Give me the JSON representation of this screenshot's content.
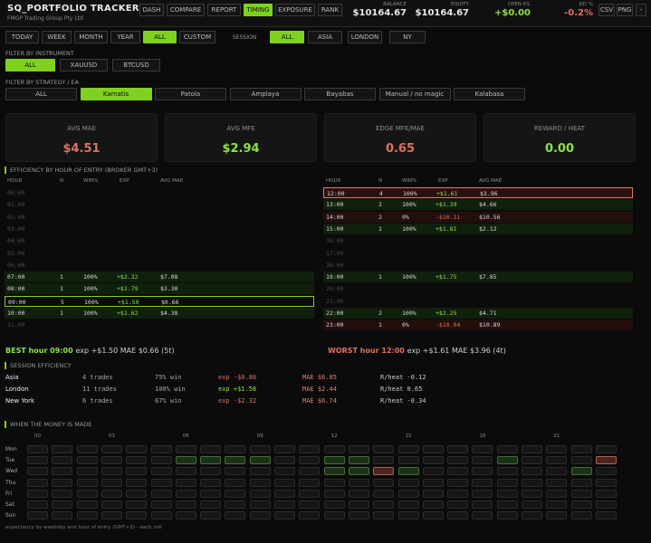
{
  "header": {
    "brand": "SQ_PORTFOLIO TRACKER",
    "company": "FMGP Trading Group Pty Ltd",
    "nav": [
      "DASH",
      "COMPARE",
      "REPORT",
      "TIMING",
      "EXPOSURE",
      "RANK"
    ],
    "nav_active": "TIMING",
    "stats": [
      {
        "label": "BALANCE",
        "value": "$10164.67",
        "color": "#e8e8e8"
      },
      {
        "label": "EQUITY",
        "value": "$10164.67",
        "color": "#e8e8e8"
      },
      {
        "label": "OPEN P/L",
        "value": "+$0.00",
        "color": "#8de04a"
      },
      {
        "label": "DD %",
        "value": "-0.2%",
        "color": "#e0705e"
      }
    ],
    "exports": [
      "CSV",
      "PNG",
      "-"
    ]
  },
  "periods": [
    "TODAY",
    "WEEK",
    "MONTH",
    "YEAR",
    "ALL",
    "CUSTOM"
  ],
  "period_active": "ALL",
  "session_label": "SESSION",
  "sessions": [
    "ALL",
    "ASIA",
    "LONDON",
    "NY"
  ],
  "session_active": "ALL",
  "instrument_label": "FILTER BY INSTRUMENT",
  "instruments": [
    "ALL",
    "XAUUSD",
    "BTCUSD"
  ],
  "instrument_active": "ALL",
  "strategy_label": "FILTER BY STRATEGY / EA",
  "strategies": [
    "ALL",
    "Kamatis",
    "Patola",
    "Amplaya",
    "Bayabas",
    "Manual / no magic",
    "Kalabasa"
  ],
  "strategy_active": "Kamatis",
  "cards": [
    {
      "title": "AVG MAE",
      "value": "$4.51",
      "color": "#e0705e"
    },
    {
      "title": "AVG MFE",
      "value": "$2.94",
      "color": "#8de04a"
    },
    {
      "title": "EDGE  MFE/MAE",
      "value": "0.65",
      "color": "#e0705e"
    },
    {
      "title": "REWARD / HEAT",
      "value": "0.00",
      "color": "#8de04a"
    }
  ],
  "efficiency_title": "EFFICIENCY BY HOUR OF ENTRY (broker GMT+3)",
  "table_headers": [
    "HOUR",
    "N",
    "WIN%",
    "EXP",
    "AVG MAE"
  ],
  "hours_left": [
    {
      "h": "00:00",
      "n": "",
      "w": "",
      "e": "",
      "m": "",
      "s": ""
    },
    {
      "h": "01:00",
      "n": "",
      "w": "",
      "e": "",
      "m": "",
      "s": ""
    },
    {
      "h": "02:00",
      "n": "",
      "w": "",
      "e": "",
      "m": "",
      "s": ""
    },
    {
      "h": "03:00",
      "n": "",
      "w": "",
      "e": "",
      "m": "",
      "s": ""
    },
    {
      "h": "04:00",
      "n": "",
      "w": "",
      "e": "",
      "m": "",
      "s": ""
    },
    {
      "h": "05:00",
      "n": "",
      "w": "",
      "e": "",
      "m": "",
      "s": ""
    },
    {
      "h": "06:00",
      "n": "",
      "w": "",
      "e": "",
      "m": "",
      "s": ""
    },
    {
      "h": "07:00",
      "n": "1",
      "w": "100%",
      "e": "+$2.32",
      "m": "$7.08",
      "s": "pos"
    },
    {
      "h": "08:00",
      "n": "1",
      "w": "100%",
      "e": "+$1.79",
      "m": "$3.30",
      "s": "pos"
    },
    {
      "h": "09:00",
      "n": "5",
      "w": "100%",
      "e": "+$1.50",
      "m": "$0.66",
      "s": "best"
    },
    {
      "h": "10:00",
      "n": "1",
      "w": "100%",
      "e": "+$1.62",
      "m": "$4.38",
      "s": "pos"
    },
    {
      "h": "11:00",
      "n": "",
      "w": "",
      "e": "",
      "m": "",
      "s": ""
    }
  ],
  "hours_right": [
    {
      "h": "12:00",
      "n": "4",
      "w": "100%",
      "e": "+$1.61",
      "m": "$3.96",
      "s": "worst"
    },
    {
      "h": "13:00",
      "n": "2",
      "w": "100%",
      "e": "+$1.39",
      "m": "$4.66",
      "s": "pos"
    },
    {
      "h": "14:00",
      "n": "2",
      "w": "0%",
      "e": "-$10.11",
      "m": "$10.56",
      "s": "neg"
    },
    {
      "h": "15:00",
      "n": "1",
      "w": "100%",
      "e": "+$1.81",
      "m": "$2.12",
      "s": "pos"
    },
    {
      "h": "16:00",
      "n": "",
      "w": "",
      "e": "",
      "m": "",
      "s": ""
    },
    {
      "h": "17:00",
      "n": "",
      "w": "",
      "e": "",
      "m": "",
      "s": ""
    },
    {
      "h": "18:00",
      "n": "",
      "w": "",
      "e": "",
      "m": "",
      "s": ""
    },
    {
      "h": "19:00",
      "n": "1",
      "w": "100%",
      "e": "+$1.75",
      "m": "$7.85",
      "s": "pos"
    },
    {
      "h": "20:00",
      "n": "",
      "w": "",
      "e": "",
      "m": "",
      "s": ""
    },
    {
      "h": "21:00",
      "n": "",
      "w": "",
      "e": "",
      "m": "",
      "s": ""
    },
    {
      "h": "22:00",
      "n": "2",
      "w": "100%",
      "e": "+$2.25",
      "m": "$4.71",
      "s": "pos"
    },
    {
      "h": "23:00",
      "n": "1",
      "w": "0%",
      "e": "-$10.04",
      "m": "$10.89",
      "s": "neg"
    }
  ],
  "best": {
    "label": "BEST hour 09:00",
    "exp": "exp +$1.50",
    "mae": "MAE $0.66",
    "count": "(5t)"
  },
  "worst": {
    "label": "WORST hour 12:00",
    "exp": "exp +$1.61",
    "mae": "MAE $3.96",
    "count": "(4t)"
  },
  "session_title": "SESSION EFFICIENCY",
  "session_rows": [
    {
      "name": "Asia",
      "trades": "4 trades",
      "win": "75% win",
      "exp": "exp -$0.80",
      "mae": "MAE $6.85",
      "heat": "R/heat -0.12"
    },
    {
      "name": "London",
      "trades": "11 trades",
      "win": "100% win",
      "exp": "exp +$1.58",
      "mae": "MAE $2.44",
      "heat": "R/heat 0.65"
    },
    {
      "name": "New York",
      "trades": "6 trades",
      "win": "67% win",
      "exp": "exp -$2.32",
      "mae": "MAE $6.74",
      "heat": "R/heat -0.34"
    }
  ],
  "heatmap_title": "WHEN THE MONEY IS MADE",
  "heatmap_hour_labels": [
    "00",
    "03",
    "06",
    "09",
    "12",
    "15",
    "18",
    "21"
  ],
  "heatmap_days": [
    "Mon",
    "Tue",
    "Wed",
    "Thu",
    "Fri",
    "Sat",
    "Sun"
  ],
  "heatmap_cells": {
    "Tue": {
      "7": "pos",
      "8": "pos",
      "9": "pos",
      "10": "pos",
      "13": "pos",
      "14": "pos",
      "20": "pos",
      "24": "neg"
    },
    "Wed": {
      "13": "pos",
      "14": "pos",
      "15": "neg",
      "16": "pos",
      "23": "pos"
    }
  },
  "footer": "expectancy by weekday and hour of entry (GMT+3)  -  each cell"
}
